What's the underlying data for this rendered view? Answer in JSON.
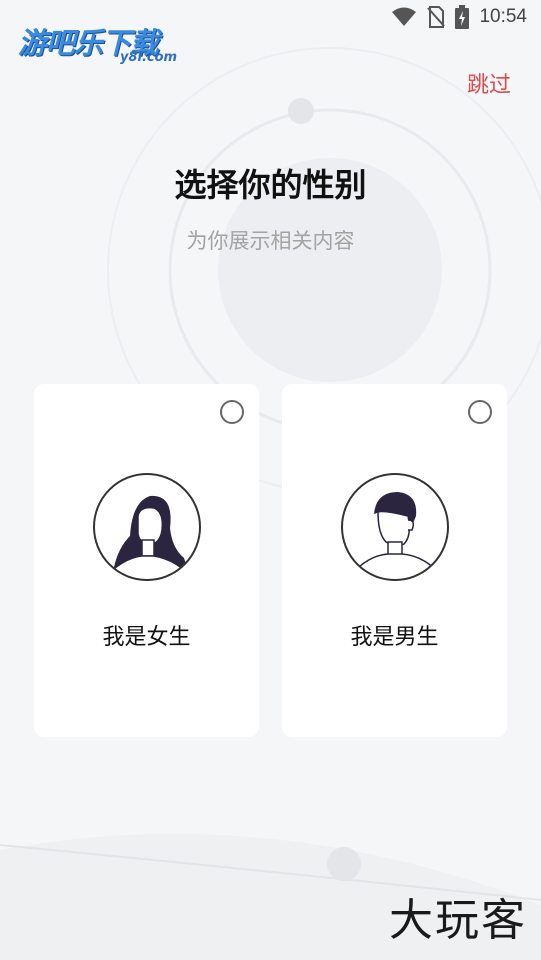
{
  "status_bar": {
    "time": "10:54",
    "icons": [
      "wifi-icon",
      "no-sim-icon",
      "battery-charging-icon"
    ]
  },
  "logo": {
    "name": "游吧乐下载",
    "domain": "y8l.com"
  },
  "header": {
    "skip_label": "跳过"
  },
  "main": {
    "title": "选择你的性别",
    "subtitle": "为你展示相关内容"
  },
  "options": [
    {
      "label": "我是女生",
      "selected": false,
      "icon": "female-avatar-icon"
    },
    {
      "label": "我是男生",
      "selected": false,
      "icon": "male-avatar-icon"
    }
  ],
  "watermark": {
    "text": "大玩客"
  },
  "colors": {
    "accent": "#e04a4a",
    "background": "#f5f6f8",
    "card": "#ffffff"
  }
}
